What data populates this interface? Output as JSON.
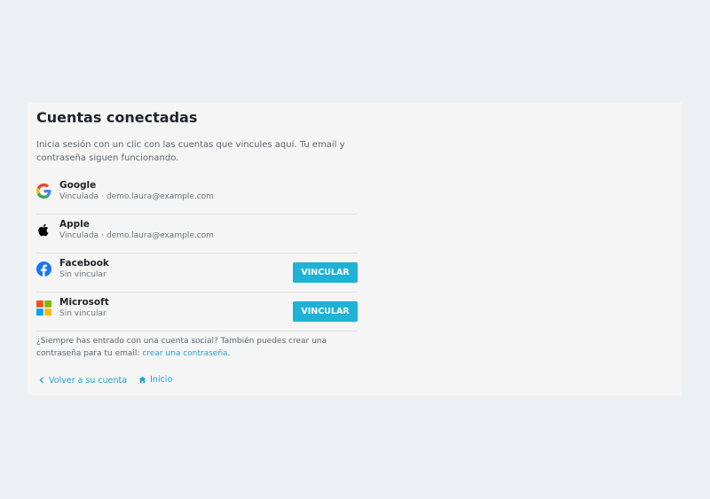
{
  "page": {
    "title": "Cuentas conectadas",
    "intro": "Inicia sesión con un clic con las cuentas que vincules aquí. Tu email y contraseña siguen funcionando."
  },
  "accounts": [
    {
      "provider": "Google",
      "icon": "google-icon",
      "status": "Vinculada",
      "email": "demo.laura@example.com",
      "linked": true
    },
    {
      "provider": "Apple",
      "icon": "apple-icon",
      "status": "Vinculada",
      "email": "demo.laura@example.com",
      "linked": true
    },
    {
      "provider": "Facebook",
      "icon": "facebook-icon",
      "status": "Sin vincular",
      "button_label": "VINCULAR",
      "linked": false
    },
    {
      "provider": "Microsoft",
      "icon": "microsoft-icon",
      "status": "Sin vincular",
      "button_label": "VINCULAR",
      "linked": false
    }
  ],
  "note": {
    "text": "¿Siempre has entrado con una cuenta social? También puedes crear una contraseña para tu email:",
    "link_label": "crear una contraseña",
    "suffix": "."
  },
  "footer": {
    "back_label": "Volver a su cuenta",
    "back_icon": "chevron-left-icon",
    "home_label": "Inicio",
    "home_icon": "home-icon"
  },
  "colors": {
    "background": "#edf0f3",
    "panel": "#f5f5f5",
    "accent": "#1eb2d6",
    "link": "#1ea6cc"
  }
}
